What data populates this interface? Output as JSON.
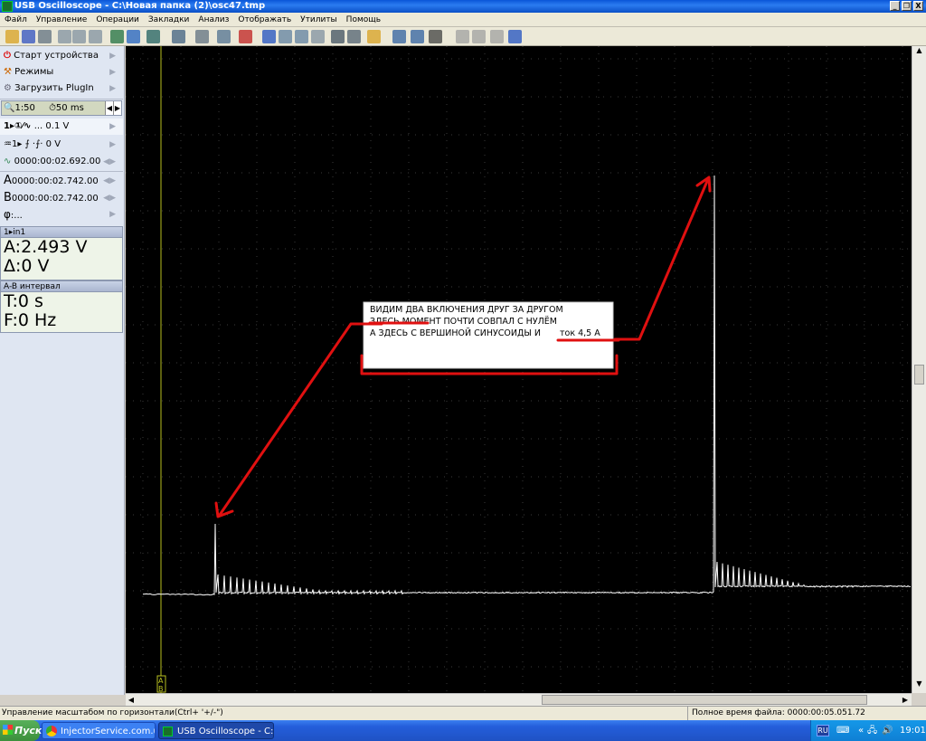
{
  "window": {
    "title": "USB Oscilloscope - C:\\Новая папка (2)\\osc47.tmp",
    "controls": [
      "_",
      "❐",
      "X"
    ]
  },
  "menu": [
    "Файл",
    "Управление",
    "Операции",
    "Закладки",
    "Анализ",
    "Отображать",
    "Утилиты",
    "Помощь"
  ],
  "toolbar_icons": [
    "open-icon",
    "save-icon",
    "print-icon",
    "copy-icon",
    "paste-icon",
    "cut-icon",
    "cursor-icon",
    "marker-icon",
    "trigger-icon",
    "measure-icon",
    "undo-icon",
    "zoom-icon",
    "delete-icon",
    "check-icon",
    "check2-icon",
    "check3-icon",
    "page-icon",
    "grid-icon",
    "export-icon",
    "folder-icon",
    "channel-a-icon",
    "channel-b-icon",
    "display-icon",
    "stop-icon",
    "page2-icon",
    "page3-icon",
    "help-icon"
  ],
  "left_panel": {
    "start_device": "Старт устройства",
    "modes": "Режимы",
    "load_plugin": "Загрузить PlugIn",
    "zoom": "1:50",
    "timebase": "50 ms",
    "channel_row": "... 0.1 V",
    "trigger_row": "0 V",
    "trigger_time": "0000:00:02.692.00",
    "cursor_a_label": "A",
    "cursor_a": "0000:00:02.742.00",
    "cursor_b_label": "B",
    "cursor_b": "0000:00:02.742.00",
    "phi_label": "φ",
    "phi": "...",
    "panel1_title": "in1",
    "panel1_a": "A:2.493 V",
    "panel1_delta": "Δ:0 V",
    "panel2_title": "A-B интервал",
    "panel2_t": "T:0 s",
    "panel2_f": "F:0 Hz"
  },
  "annotation": {
    "line1": "ВИДИМ  ДВА  ВКЛЮЧЕНИЯ  ДРУГ  ЗА  ДРУГОМ",
    "line2": "ЗДЕСЬ  МОМЕНТ  ПОЧТИ  СОВПАЛ  С  НУЛЁМ",
    "line3a": "А  ЗДЕСЬ  С  ВЕРШИНОЙ  СИНУСОИДЫ  И",
    "line3b": "ток 4,5 А"
  },
  "cursor_marker": {
    "a": "A",
    "b": "B"
  },
  "status": {
    "left": "Управление масштабом по горизонтали(Ctrl+ '+/-\")",
    "right": "Полное время файла: 0000:00:05.051.72"
  },
  "taskbar": {
    "start": "Пуск",
    "items": [
      "InjectorService.com.ua ...",
      "USB Oscilloscope - C:\\..."
    ],
    "lang": "RU",
    "clock": "19:01"
  },
  "colors": {
    "scope_bg": "#000000",
    "grid_dot": "#3a3a3a",
    "signal": "#ffffff",
    "cursor_line": "#b8c020",
    "arrow": "#e01010"
  }
}
